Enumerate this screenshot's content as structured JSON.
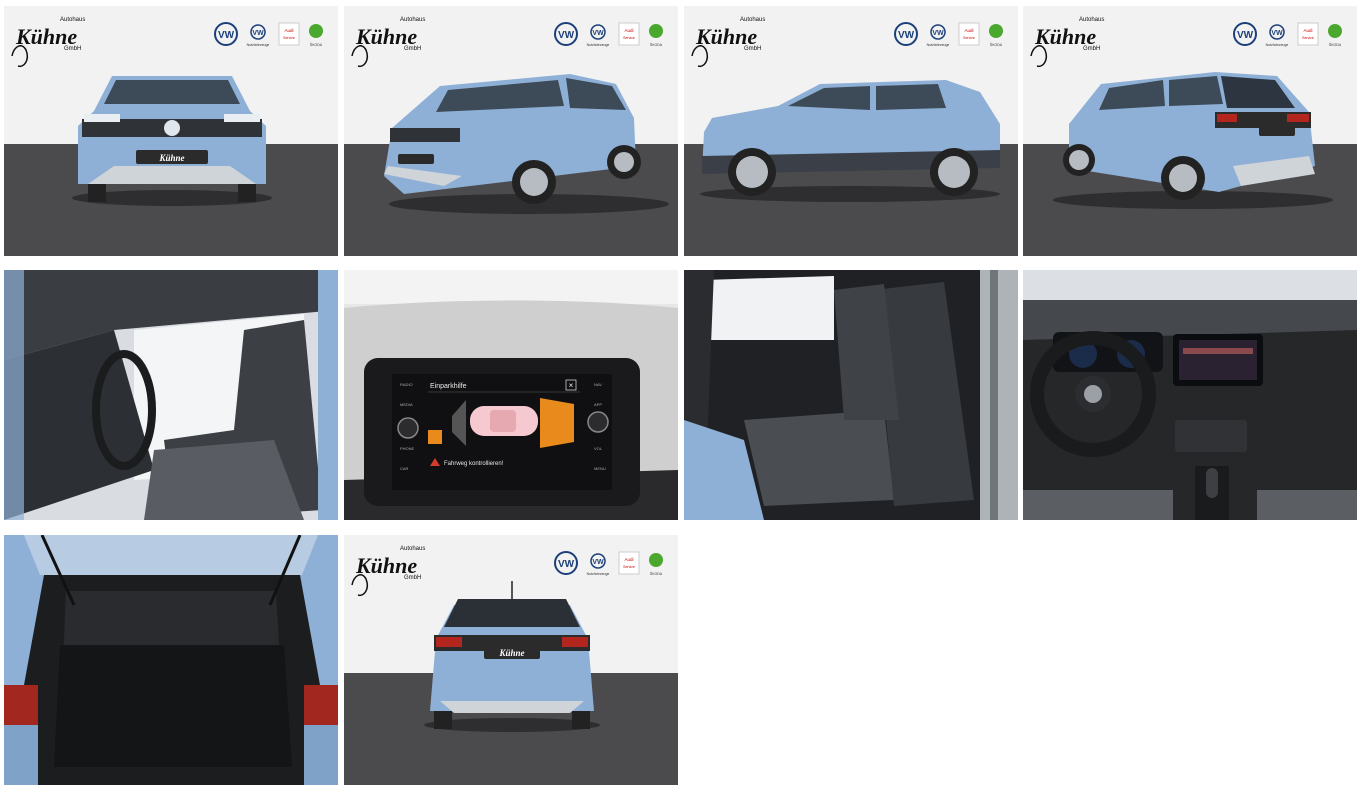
{
  "dealer": {
    "name": "Kühne",
    "top": "Autohaus",
    "suffix": "GmbH",
    "plate_text": "Kühne",
    "brand_caption": "Nutzfahrzeuge",
    "audi_caption": "Audi",
    "audi_caption2": "Service",
    "skoda_caption": "ŠKODA",
    "vw_emblem": "VW"
  },
  "screen": {
    "title": "Einparkhilfe",
    "close": "×",
    "warning": "Fahrweg kontrollieren!",
    "left_menu": [
      "RADIO",
      "MEDIA",
      "",
      "PHONE",
      "CAR"
    ],
    "right_menu": [
      "NAV",
      "APP",
      "",
      "VOL",
      "MENU"
    ]
  },
  "colors": {
    "car_blue": "#8fb0d6",
    "car_dark": "#3b4048",
    "floor": "#4b4b4d",
    "wall": "#f1f1f1",
    "screen_orange": "#e88a1c",
    "screen_red": "#d33c2a"
  },
  "gallery": [
    {
      "name": "photo-exterior-front",
      "kind": "studio-front"
    },
    {
      "name": "photo-exterior-front-three-quarter",
      "kind": "studio-3q"
    },
    {
      "name": "photo-exterior-side",
      "kind": "studio-side"
    },
    {
      "name": "photo-exterior-rear-three-quarter",
      "kind": "studio-rear3q"
    },
    {
      "name": "photo-interior-front-seats",
      "kind": "interior-seats"
    },
    {
      "name": "photo-infotainment-parking-assist",
      "kind": "screen"
    },
    {
      "name": "photo-interior-rear-seats",
      "kind": "rear-seats"
    },
    {
      "name": "photo-dashboard",
      "kind": "dashboard"
    },
    {
      "name": "photo-trunk",
      "kind": "trunk"
    },
    {
      "name": "photo-exterior-rear",
      "kind": "studio-rear"
    }
  ]
}
